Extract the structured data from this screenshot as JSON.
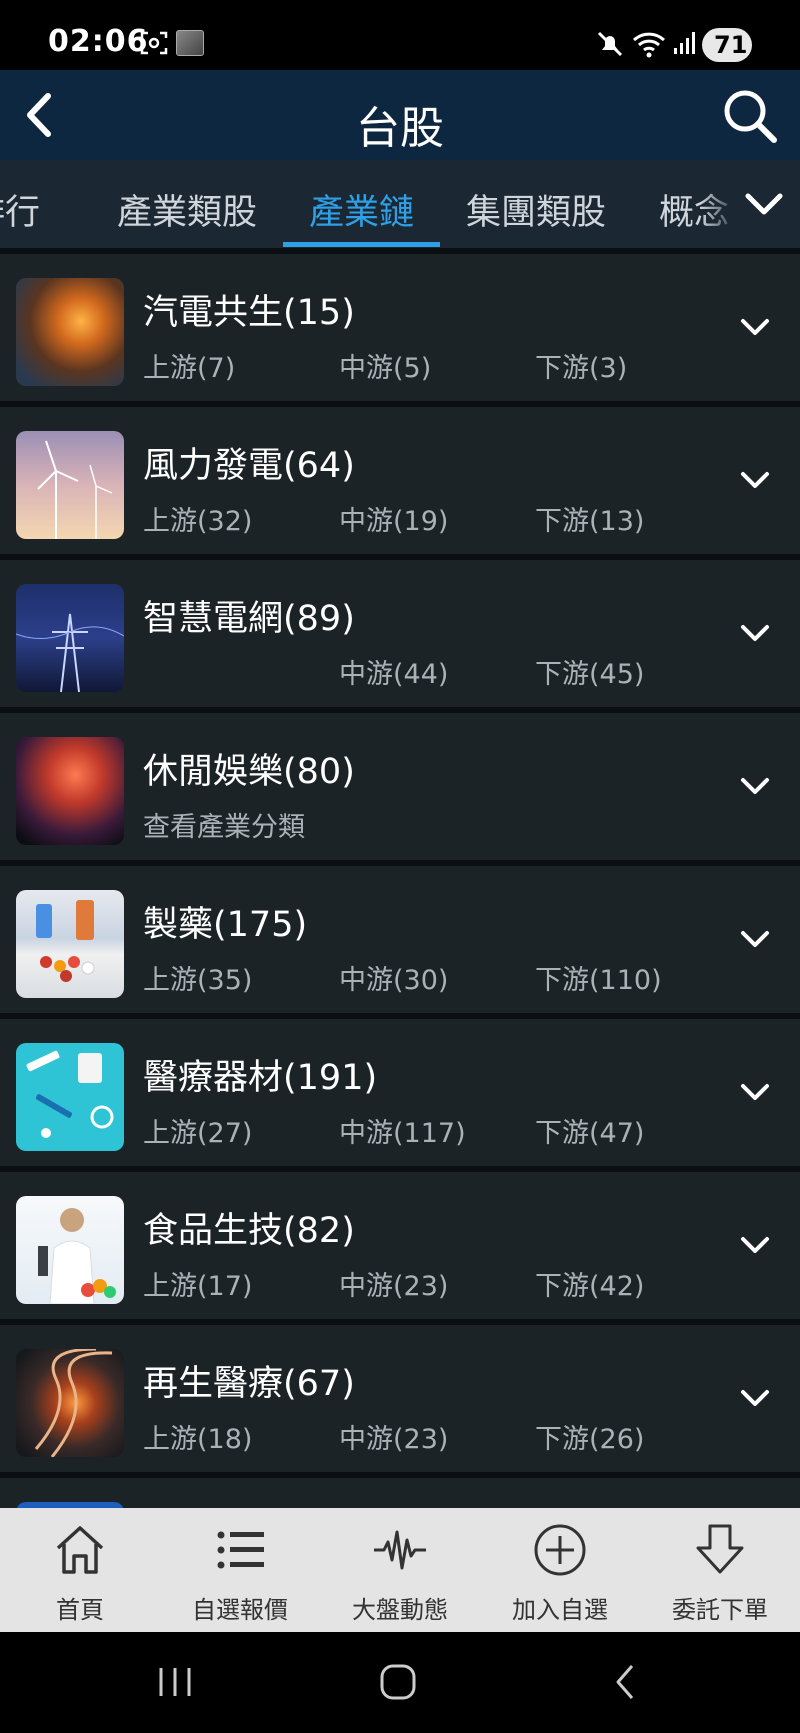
{
  "status_bar": {
    "time": "02:06",
    "battery": "71"
  },
  "header": {
    "title": "台股"
  },
  "tabs": [
    {
      "label": "排行"
    },
    {
      "label": "產業類股"
    },
    {
      "label": "產業鏈"
    },
    {
      "label": "集團類股"
    },
    {
      "label": "概念"
    }
  ],
  "colors": {
    "accent": "#2f9fe6",
    "header_bg": "#0e2740",
    "card_bg": "#1c2327"
  },
  "industries": [
    {
      "name": "汽電共生(15)",
      "upstream": "上游(7)",
      "midstream": "中游(5)",
      "downstream": "下游(3)",
      "note": ""
    },
    {
      "name": "風力發電(64)",
      "upstream": "上游(32)",
      "midstream": "中游(19)",
      "downstream": "下游(13)",
      "note": ""
    },
    {
      "name": "智慧電網(89)",
      "upstream": "",
      "midstream": "中游(44)",
      "downstream": "下游(45)",
      "note": ""
    },
    {
      "name": "休閒娛樂(80)",
      "upstream": "",
      "midstream": "",
      "downstream": "",
      "note": "查看產業分類"
    },
    {
      "name": "製藥(175)",
      "upstream": "上游(35)",
      "midstream": "中游(30)",
      "downstream": "下游(110)",
      "note": ""
    },
    {
      "name": "醫療器材(191)",
      "upstream": "上游(27)",
      "midstream": "中游(117)",
      "downstream": "下游(47)",
      "note": ""
    },
    {
      "name": "食品生技(82)",
      "upstream": "上游(17)",
      "midstream": "中游(23)",
      "downstream": "下游(42)",
      "note": ""
    },
    {
      "name": "再生醫療(67)",
      "upstream": "上游(18)",
      "midstream": "中游(23)",
      "downstream": "下游(26)",
      "note": ""
    }
  ],
  "bottom_nav": [
    {
      "label": "首頁",
      "icon": "home-icon"
    },
    {
      "label": "自選報價",
      "icon": "list-icon"
    },
    {
      "label": "大盤動態",
      "icon": "pulse-icon"
    },
    {
      "label": "加入自選",
      "icon": "add-circle-icon"
    },
    {
      "label": "委託下單",
      "icon": "download-arrow-icon"
    }
  ]
}
